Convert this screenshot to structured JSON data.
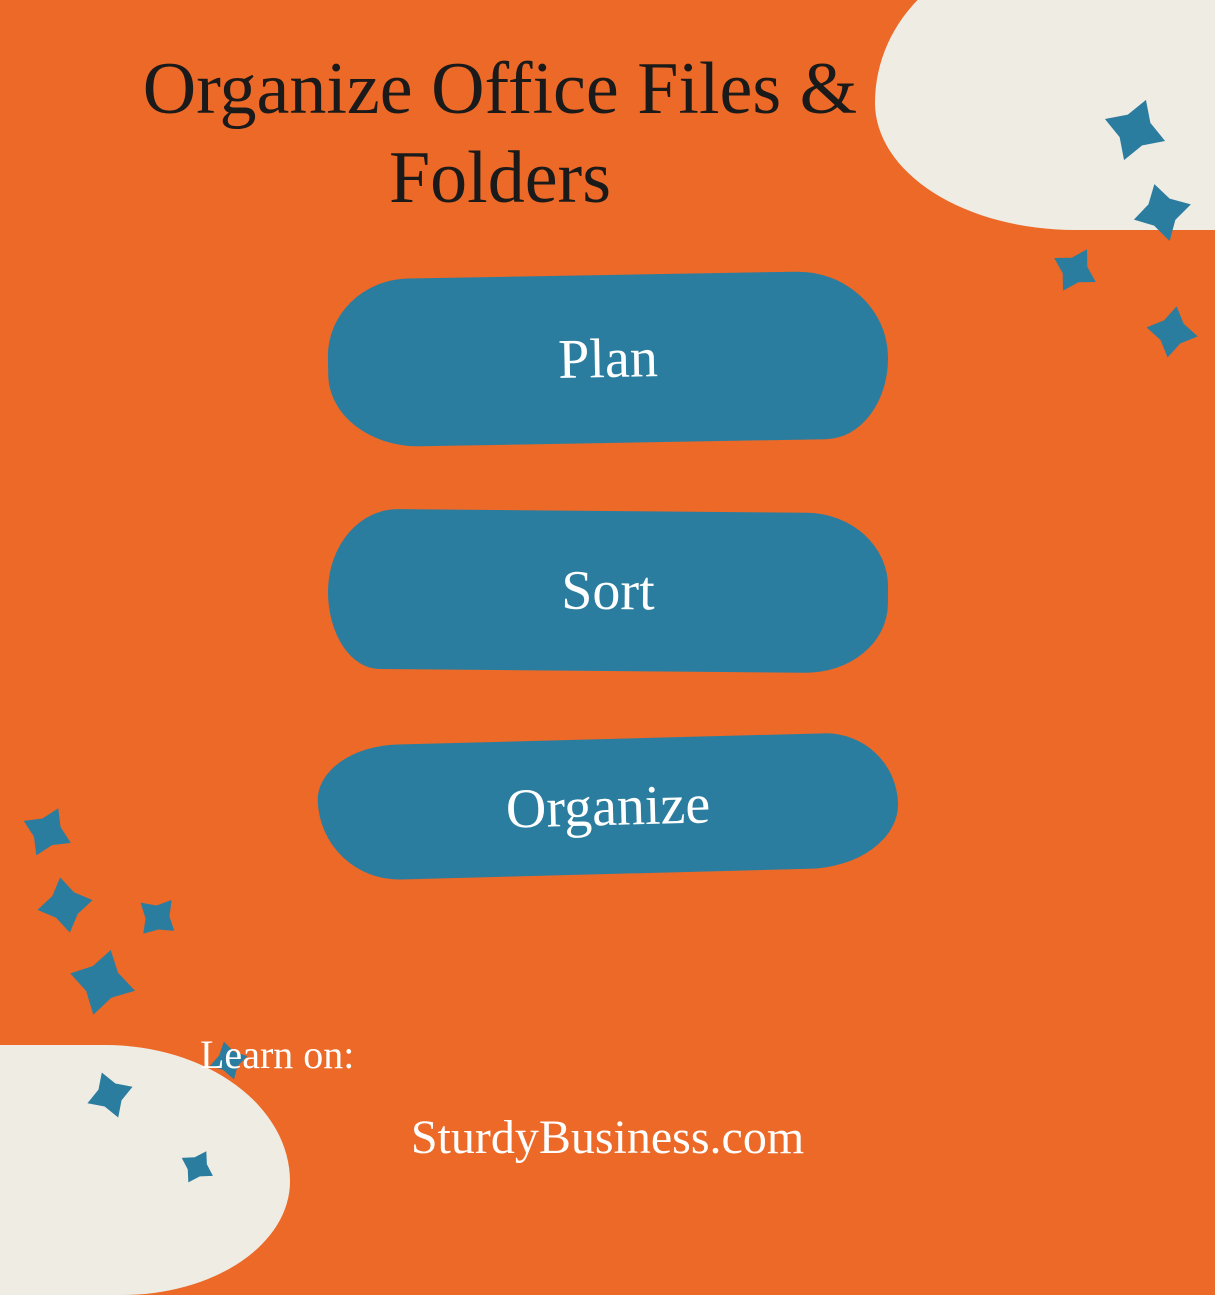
{
  "title": "Organize Office Files & Folders",
  "steps": {
    "items": [
      {
        "label": "Plan"
      },
      {
        "label": "Sort"
      },
      {
        "label": "Organize"
      }
    ]
  },
  "footer": {
    "lead": "Learn on:",
    "site": "SturdyBusiness.com"
  },
  "colors": {
    "background": "#ec6927",
    "blob": "#2b7d9f",
    "blobLight": "#efece4",
    "text": "#1a1a1a",
    "textLight": "#ffffff"
  }
}
